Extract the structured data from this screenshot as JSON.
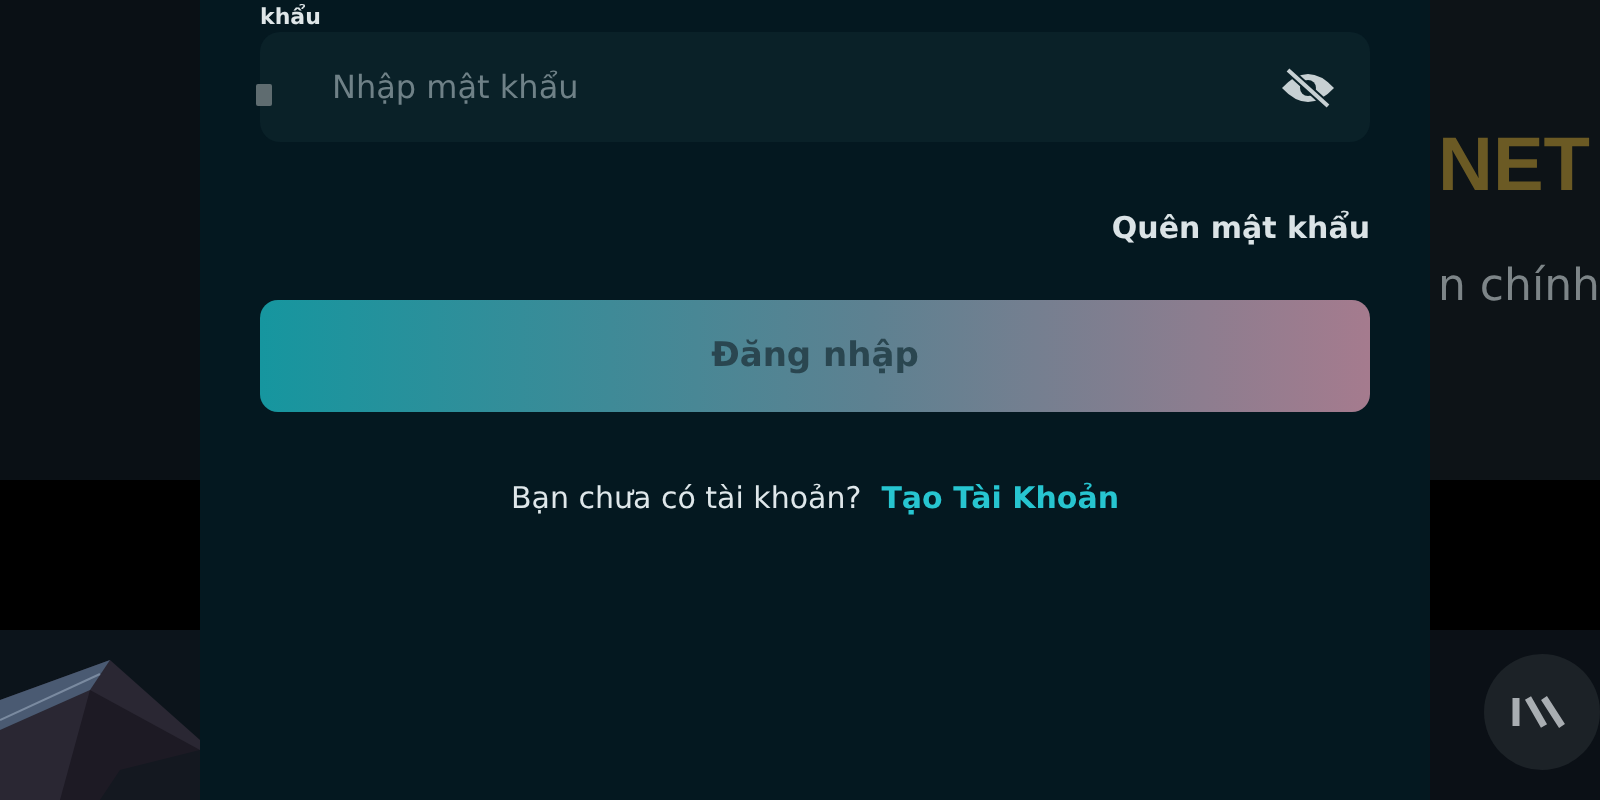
{
  "password_label": "khẩu",
  "password_field": {
    "placeholder": "Nhập mật khẩu",
    "visible": false
  },
  "forgot_link": "Quên mật khẩu",
  "login_button": "Đăng nhập",
  "signup_prompt": "Bạn chưa có tài khoản?",
  "signup_link": "Tạo Tài Khoản",
  "background": {
    "headline": "NET",
    "subtitle": "n chính"
  }
}
